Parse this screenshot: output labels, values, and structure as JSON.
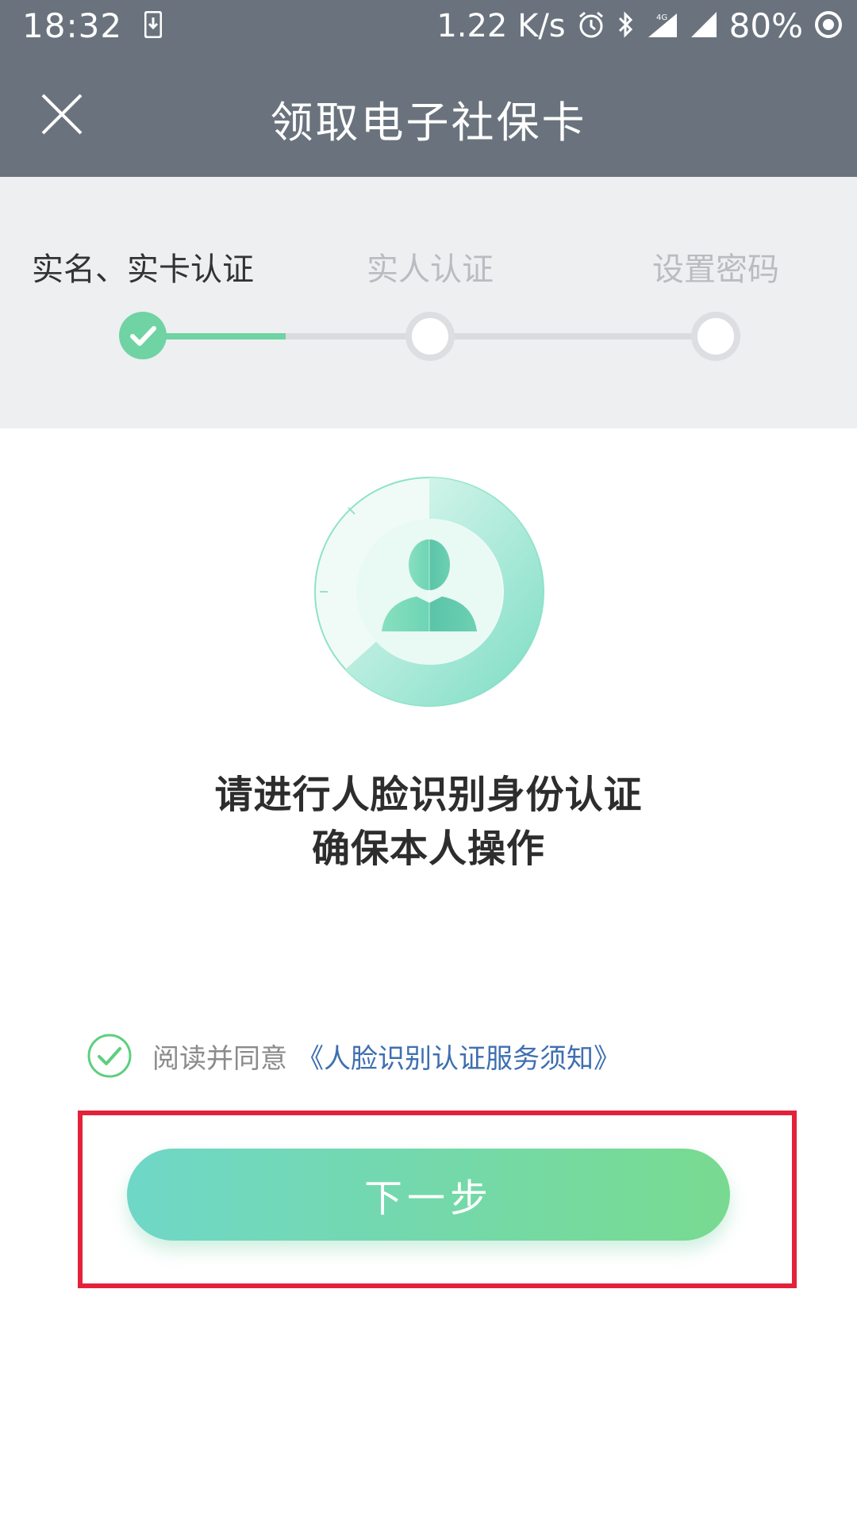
{
  "status_bar": {
    "time": "18:32",
    "speed": "1.22 K/s",
    "battery": "80%",
    "icons": [
      "download-icon",
      "alarm-icon",
      "bluetooth-icon",
      "4g-signal-icon",
      "signal-icon",
      "battery-icon"
    ]
  },
  "header": {
    "title": "领取电子社保卡",
    "close_icon": "close-icon"
  },
  "stepper": {
    "steps": [
      {
        "label": "实名、实卡认证",
        "state": "done"
      },
      {
        "label": "实人认证",
        "state": "pending"
      },
      {
        "label": "设置密码",
        "state": "pending"
      }
    ],
    "accent": "#6fd3a3"
  },
  "main": {
    "illustration": "face-avatar-icon",
    "headline_line1": "请进行人脸识别身份认证",
    "headline_line2": "确保本人操作"
  },
  "agreement": {
    "checked": true,
    "text": "阅读并同意",
    "link": "《人脸识别认证服务须知》"
  },
  "next_button": {
    "label": "下一步"
  },
  "colors": {
    "header_bg": "#6a737d",
    "highlight": "#e3223a",
    "button_start": "#6fd7c7",
    "button_end": "#78da90",
    "link": "#3f6fb0"
  }
}
